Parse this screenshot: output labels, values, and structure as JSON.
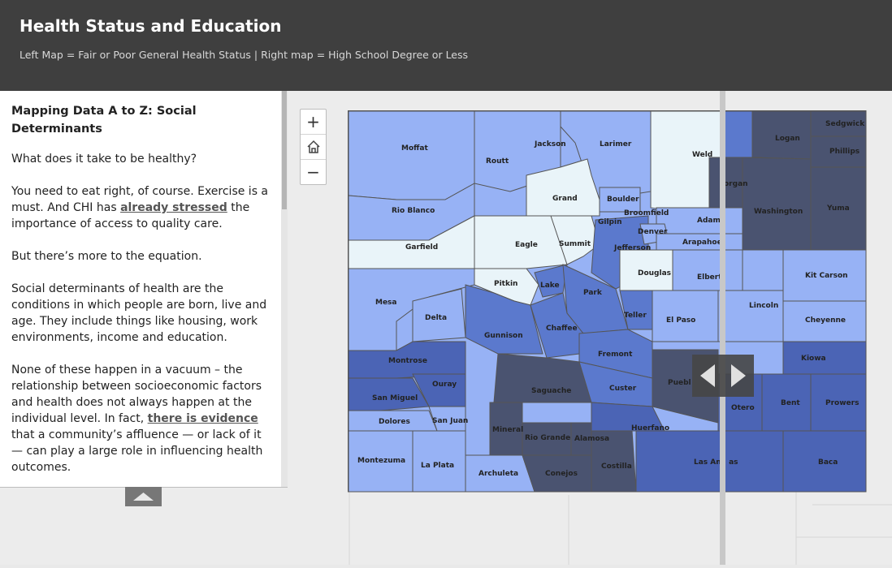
{
  "header": {
    "title": "Health Status and Education",
    "subtitle": "Left Map = Fair or Poor General Health Status | Right map = High School Degree or Less"
  },
  "panel": {
    "heading": "Mapping Data A to Z: Social Determinants",
    "p1": "What does it take to be healthy?",
    "p2_a": "You need to eat right, of course. Exercise is a must. And CHI has ",
    "p2_link": "already stressed",
    "p2_b": " the importance of access to quality care.",
    "p3": "But there’s more to the equation.",
    "p4": "Social determinants of health are the conditions in which people are born, live and age. They include things like housing, work environments, income and education.",
    "p5_a": "None of these happen in a vacuum – the relationship between socioeconomic factors and health does not always happen at the individual level. In fact, ",
    "p5_link": "there is evidence",
    "p5_b": " that a community’s affluence — or lack of it — can play a large role in influencing health outcomes."
  },
  "zoom": {
    "in": "+",
    "home": "home-icon",
    "out": "−"
  },
  "colors": {
    "lightest": "#e9f4f9",
    "light": "#97b2f5",
    "medium": "#5b79cd",
    "dark": "#4b64b5",
    "darkest": "#4a5370"
  },
  "map": {
    "counties": {
      "moffat": "Moffat",
      "routt": "Routt",
      "jackson": "Jackson",
      "larimer": "Larimer",
      "weld": "Weld",
      "sedgwick": "Sedgwick",
      "logan": "Logan",
      "phillips": "Phillips",
      "morgan": "organ",
      "rio_blanco": "Rio Blanco",
      "grand": "Grand",
      "boulder": "Boulder",
      "broomfield": "Broomfield",
      "gilpin": "Gilpin",
      "adams": "Adams",
      "washington": "Washington",
      "yuma": "Yuma",
      "denver": "Denver",
      "garfield": "Garfield",
      "eagle": "Eagle",
      "summit": "Summit",
      "jefferson": "Jefferson",
      "arapahoe": "Arapahoe",
      "douglas": "Douglas",
      "elbert": "Elbert",
      "kit_carson": "Kit Carson",
      "pitkin": "Pitkin",
      "lake": "Lake",
      "park": "Park",
      "mesa": "Mesa",
      "delta": "Delta",
      "lincoln": "Lincoln",
      "teller": "Teller",
      "el_paso": "El Paso",
      "cheyenne": "Cheyenne",
      "chaffee": "Chaffee",
      "gunnison": "Gunnison",
      "fremont": "Fremont",
      "montrose": "Montrose",
      "kiowa": "Kiowa",
      "ouray": "Ouray",
      "saguache": "Saguache",
      "custer": "Custer",
      "pueblo": "Puebl",
      "san_miguel": "San Miguel",
      "bent": "Bent",
      "prowers": "Prowers",
      "otero": "Otero",
      "dolores": "Dolores",
      "san_juan": "San Juan",
      "mineral": "Mineral",
      "huerfano": "Huerfano",
      "rio_grande": "Rio Grande",
      "alamosa": "Alamosa",
      "montezuma": "Montezuma",
      "la_plata": "La Plata",
      "archuleta": "Archuleta",
      "conejos": "Conejos",
      "costilla": "Costilla",
      "las_animas": "Las An   as",
      "baca": "Baca"
    }
  }
}
